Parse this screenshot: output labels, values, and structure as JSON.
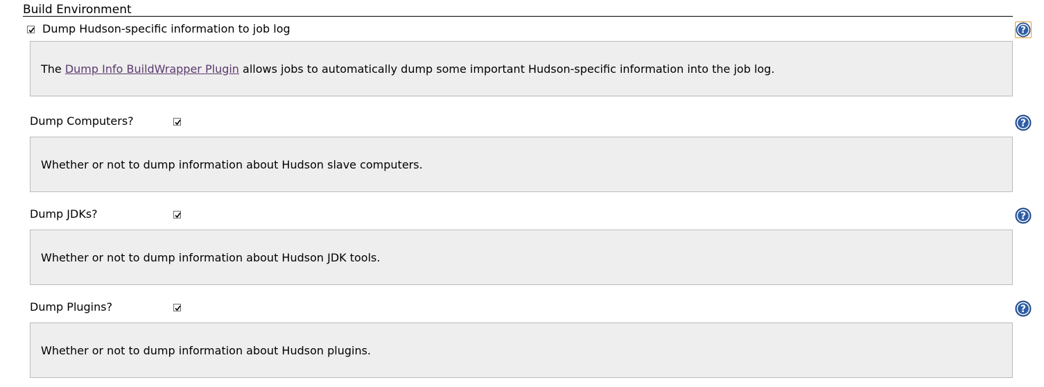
{
  "section": {
    "title": "Build Environment"
  },
  "main_option": {
    "label": "Dump Hudson-specific information to job log",
    "checked": true,
    "help": {
      "prefix": "The ",
      "link_text": "Dump Info BuildWrapper Plugin",
      "suffix": " allows jobs to automatically dump some important Hudson-specific information into the job log."
    }
  },
  "options": [
    {
      "label": "Dump Computers?",
      "checked": true,
      "help": "Whether or not to dump information about Hudson slave computers."
    },
    {
      "label": "Dump JDKs?",
      "checked": true,
      "help": "Whether or not to dump information about Hudson JDK tools."
    },
    {
      "label": "Dump Plugins?",
      "checked": true,
      "help": "Whether or not to dump information about Hudson plugins."
    }
  ],
  "icons": {
    "help": "help-question-icon",
    "check": "checkmark-icon"
  },
  "colors": {
    "help_icon": "#2f5ea5",
    "help_box_bg": "#eeeeee",
    "link": "#5a3a6e",
    "focus_ring": "#e09a3a"
  }
}
